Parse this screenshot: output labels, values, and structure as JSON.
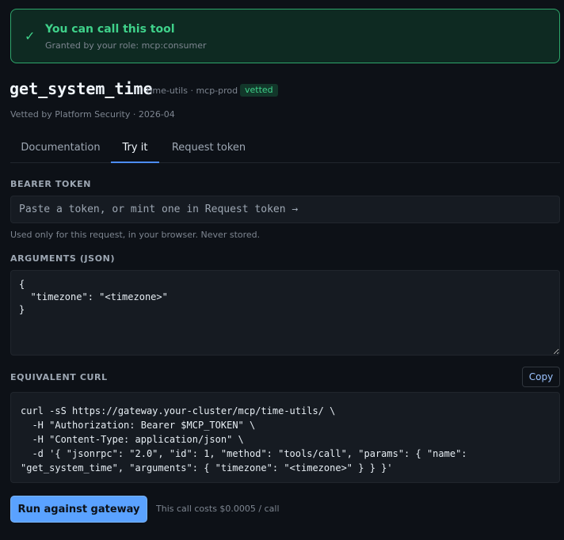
{
  "banner": {
    "title": "You can call this tool",
    "subtitle": "Granted by your role: mcp:consumer",
    "check_icon": "✓"
  },
  "tool": {
    "name": "get_system_time",
    "meta": "time-utils · mcp-prod",
    "badge": "vetted",
    "vetted_line": "Vetted by Platform Security · 2026-04"
  },
  "tabs": [
    {
      "label": "Documentation",
      "active": false
    },
    {
      "label": "Try it",
      "active": true
    },
    {
      "label": "Request token",
      "active": false
    }
  ],
  "bearer": {
    "label": "BEARER TOKEN",
    "placeholder": "Paste a token, or mint one in Request token →",
    "value": "",
    "hint": "Used only for this request, in your browser. Never stored."
  },
  "arguments": {
    "label": "ARGUMENTS (JSON)",
    "value": "{\n  \"timezone\": \"<timezone>\"\n}"
  },
  "curl": {
    "label": "EQUIVALENT CURL",
    "copy_label": "Copy",
    "command": "curl -sS https://gateway.your-cluster/mcp/time-utils/ \\\n  -H \"Authorization: Bearer $MCP_TOKEN\" \\\n  -H \"Content-Type: application/json\" \\\n  -d '{ \"jsonrpc\": \"2.0\", \"id\": 1, \"method\": \"tools/call\", \"params\": { \"name\": \"get_system_time\", \"arguments\": { \"timezone\": \"<timezone>\" } } }'"
  },
  "run": {
    "label": "Run against gateway",
    "cost": "This call costs $0.0005 / call"
  },
  "colors": {
    "accent": "#5aa2ff",
    "success": "#3fd18a",
    "background": "#0d1117"
  }
}
